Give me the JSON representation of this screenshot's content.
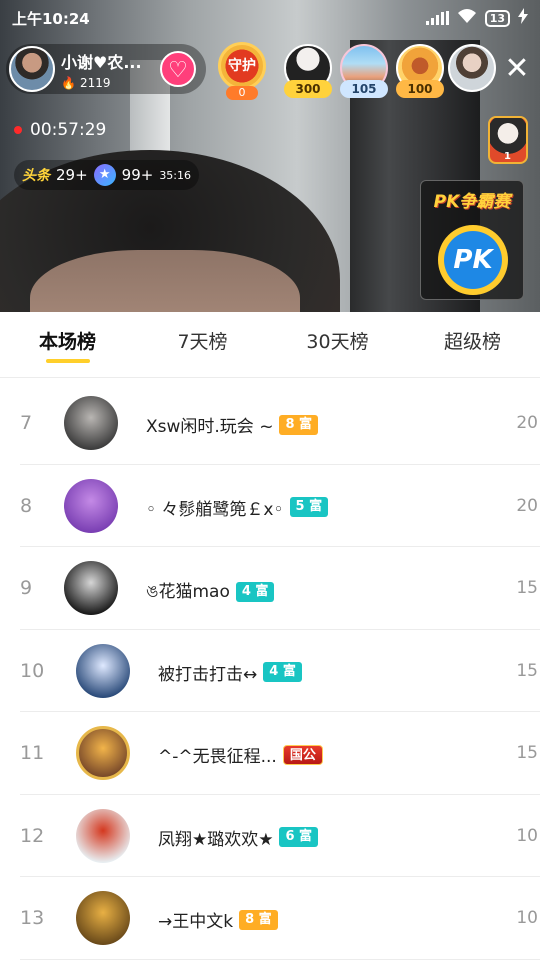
{
  "status_bar": {
    "time": "上午10:24",
    "battery": "13"
  },
  "host": {
    "name": "小谢♥农...",
    "heat": "2119"
  },
  "guard": {
    "label": "守护",
    "count": "0"
  },
  "viewers": [
    {
      "badge": "300"
    },
    {
      "badge": "105"
    },
    {
      "badge": "100"
    }
  ],
  "live_timer": "00:57:29",
  "headline_badge": {
    "label": "头条",
    "count": "29+"
  },
  "star_badge": {
    "count": "99+",
    "time": "35:16"
  },
  "top_lady_count": "1",
  "pk": {
    "title": "PK争霸赛",
    "label": "PK"
  },
  "tabs": [
    {
      "label": "本场榜",
      "active": true
    },
    {
      "label": "7天榜"
    },
    {
      "label": "30天榜"
    },
    {
      "label": "超级榜"
    }
  ],
  "ranking": [
    {
      "rank": "7",
      "name": "Xsw闲时.玩会 ~",
      "level": "8 富",
      "level_color": "#ffad24",
      "score": "20",
      "avatar_colors": [
        "#3c3c3c",
        "#b9b6b3"
      ]
    },
    {
      "rank": "8",
      "name": "◦ 々髿艏鹭篼￡x◦",
      "level": "5 富",
      "level_color": "#19c5c3",
      "score": "20",
      "avatar_colors": [
        "#7a3fb3",
        "#c48ae6"
      ]
    },
    {
      "rank": "9",
      "name": "ঙ花猫mao",
      "level": "4 富",
      "level_color": "#19c5c3",
      "score": "15",
      "avatar_colors": [
        "#1a1a1a",
        "#d6d6d6"
      ]
    },
    {
      "rank": "10",
      "name": "被打击打击↔",
      "level": "4 富",
      "level_color": "#19c5c3",
      "score": "15",
      "avatar_colors": [
        "#2b4b7a",
        "#dfe9ff"
      ]
    },
    {
      "rank": "11",
      "name": "^-^无畏征程...",
      "level": "国公",
      "level_color": "#d0281c",
      "score": "15",
      "avatar_colors": [
        "#7a4a2a",
        "#f2b44a"
      ]
    },
    {
      "rank": "12",
      "name": "凤翔★璐欢欢★",
      "level": "6 富",
      "level_color": "#19c5c3",
      "score": "10",
      "avatar_colors": [
        "#e8eef1",
        "#d4381f"
      ]
    },
    {
      "rank": "13",
      "name": "→王中文k",
      "level": "8 富",
      "level_color": "#ffad24",
      "score": "10",
      "avatar_colors": [
        "#6a4a1a",
        "#e8b044"
      ]
    }
  ]
}
